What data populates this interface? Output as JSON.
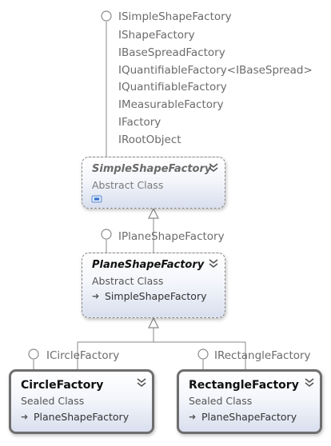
{
  "colors": {
    "connector": "#8a8a8a",
    "lollipop_stroke": "#8a8a8a",
    "box_gradient_top": "#ffffff",
    "box_gradient_bottom": "#d9dfee"
  },
  "top_interfaces": [
    "ISimpleShapeFactory",
    "IShapeFactory",
    "IBaseSpreadFactory",
    "IQuantifiableFactory<IBaseSpread>",
    "IQuantifiableFactory",
    "IMeasurableFactory",
    "IFactory",
    "IRootObject"
  ],
  "simple_shape_factory": {
    "name": "SimpleShapeFactory",
    "kind": "Abstract Class",
    "icon": "collapsed-members-icon",
    "expand_icon": "double-chevron-icon"
  },
  "plane_interface": "IPlaneShapeFactory",
  "plane_shape_factory": {
    "name": "PlaneShapeFactory",
    "kind": "Abstract Class",
    "base": "SimpleShapeFactory",
    "expand_icon": "double-chevron-icon"
  },
  "circle_interface": "ICircleFactory",
  "circle_factory": {
    "name": "CircleFactory",
    "kind": "Sealed Class",
    "base": "PlaneShapeFactory",
    "expand_icon": "double-chevron-icon"
  },
  "rectangle_interface": "IRectangleFactory",
  "rectangle_factory": {
    "name": "RectangleFactory",
    "kind": "Sealed Class",
    "base": "PlaneShapeFactory",
    "expand_icon": "double-chevron-icon"
  }
}
